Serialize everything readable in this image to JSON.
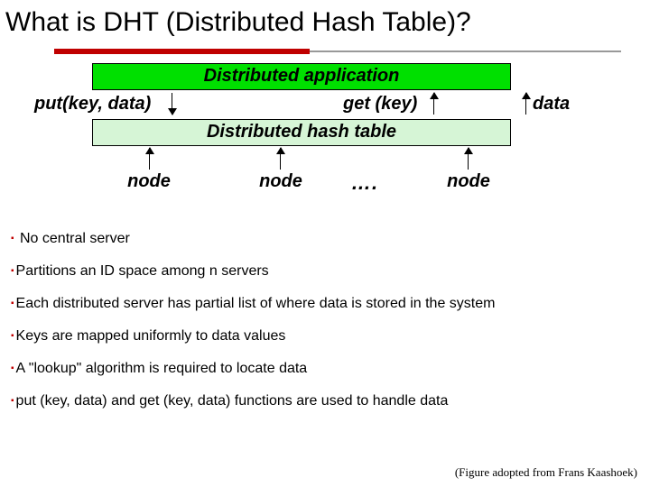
{
  "title": "What is DHT (Distributed Hash Table)?",
  "diagram": {
    "app_label": "Distributed application",
    "dht_label": "Distributed hash table",
    "put_label": "put(key, data)",
    "get_label": "get (key)",
    "data_label": "data",
    "node1": "node",
    "node2": "node",
    "node_dots": "….",
    "node4": "node"
  },
  "bullets": {
    "b1": " No central server",
    "b2": "Partitions an ID space among n servers",
    "b3": "Each distributed server has partial list of where data is stored in the system",
    "b4": "Keys are mapped uniformly to data values",
    "b5": "A \"lookup\" algorithm is required to locate data",
    "b6": "put (key, data) and get (key, data) functions are used to handle data"
  },
  "credit": "(Figure adopted from Frans Kaashoek)"
}
